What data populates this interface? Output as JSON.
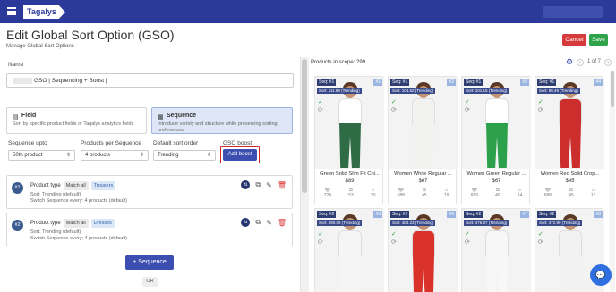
{
  "topbar": {
    "logo": "Tagalys",
    "menu_icon": "hamburger-icon"
  },
  "header": {
    "title": "Edit Global Sort Option (GSO)",
    "subtitle": "Manage Global Sort Options",
    "cancel_label": "Cancel",
    "save_label": "Save"
  },
  "form": {
    "name_label": "Name",
    "name_value": "GSO | Sequencing + Boost |",
    "type_cards": [
      {
        "title": "Field",
        "description": "Sort by specific product fields or Tagalys analytics fields",
        "icon": "field-icon"
      },
      {
        "title": "Sequence",
        "description": "Introduce variety and structure while preserving sorting preferences",
        "icon": "grid-icon"
      }
    ],
    "controls": {
      "sequence_upto_label": "Sequence upto",
      "sequence_upto_value": "50th product",
      "products_per_sequence_label": "Products per Sequence",
      "products_per_sequence_value": "4 products",
      "default_sort_label": "Default sort order",
      "default_sort_value": "Trending",
      "gso_boost_label": "GSO boost",
      "add_boost_label": "Add boost"
    },
    "sequences": [
      {
        "num": "#1",
        "product_type_label": "Product type",
        "match": "Match all",
        "value": "Trousers",
        "sort": "Sort: Trending (default)",
        "switch": "Switch Sequence every: 4 products (default)"
      },
      {
        "num": "#2",
        "product_type_label": "Product type",
        "match": "Match all",
        "value": "Dresses",
        "sort": "Sort: Trending (default)",
        "switch": "Switch Sequence every: 4 products (default)"
      }
    ],
    "add_sequence_label": "+ Sequence",
    "or_label": "OR"
  },
  "preview": {
    "scope_label": "Products in scope: 299",
    "pager": "1 of 7",
    "products": [
      {
        "seq": "Seq: #1",
        "num": "#1",
        "sort": "Sort: 111.89 (Trending)",
        "name": "Green Solid Slim Fit Chi...",
        "price": "$89",
        "views": "724",
        "carts": "53",
        "orders": "20",
        "color": "#2f6b45"
      },
      {
        "seq": "Seq: #1",
        "num": "#2",
        "sort": "Sort: 104.52 (Trending)",
        "name": "Women White Regular ...",
        "price": "$67",
        "views": "588",
        "carts": "45",
        "orders": "19",
        "color": "#f2f2f0"
      },
      {
        "seq": "Seq: #1",
        "num": "#3",
        "sort": "Sort: 101.15 (Trending)",
        "name": "Women Green Regular ...",
        "price": "$67",
        "views": "689",
        "carts": "49",
        "orders": "14",
        "color": "#2ca04a"
      },
      {
        "seq": "Seq: #1",
        "num": "#4",
        "sort": "Sort: 98.49 (Trending)",
        "name": "Women Red Solid Crop...",
        "price": "$45",
        "views": "688",
        "carts": "45",
        "orders": "13",
        "color": "#cc2e2e"
      },
      {
        "seq": "Seq: #2",
        "num": "#5",
        "sort": "Sort: 490.06 (Trending)",
        "color": "#f5f5f5"
      },
      {
        "seq": "Seq: #2",
        "num": "#6",
        "sort": "Sort: 483.23 (Trending)",
        "color": "#d8322b"
      },
      {
        "seq": "Seq: #2",
        "num": "#7",
        "sort": "Sort: 476.87 (Trending)",
        "color": "#f7f7f7"
      },
      {
        "seq": "Seq: #2",
        "num": "#8",
        "sort": "Sort: 472.99 (Trending)",
        "color": "#f2f2f2"
      }
    ]
  }
}
